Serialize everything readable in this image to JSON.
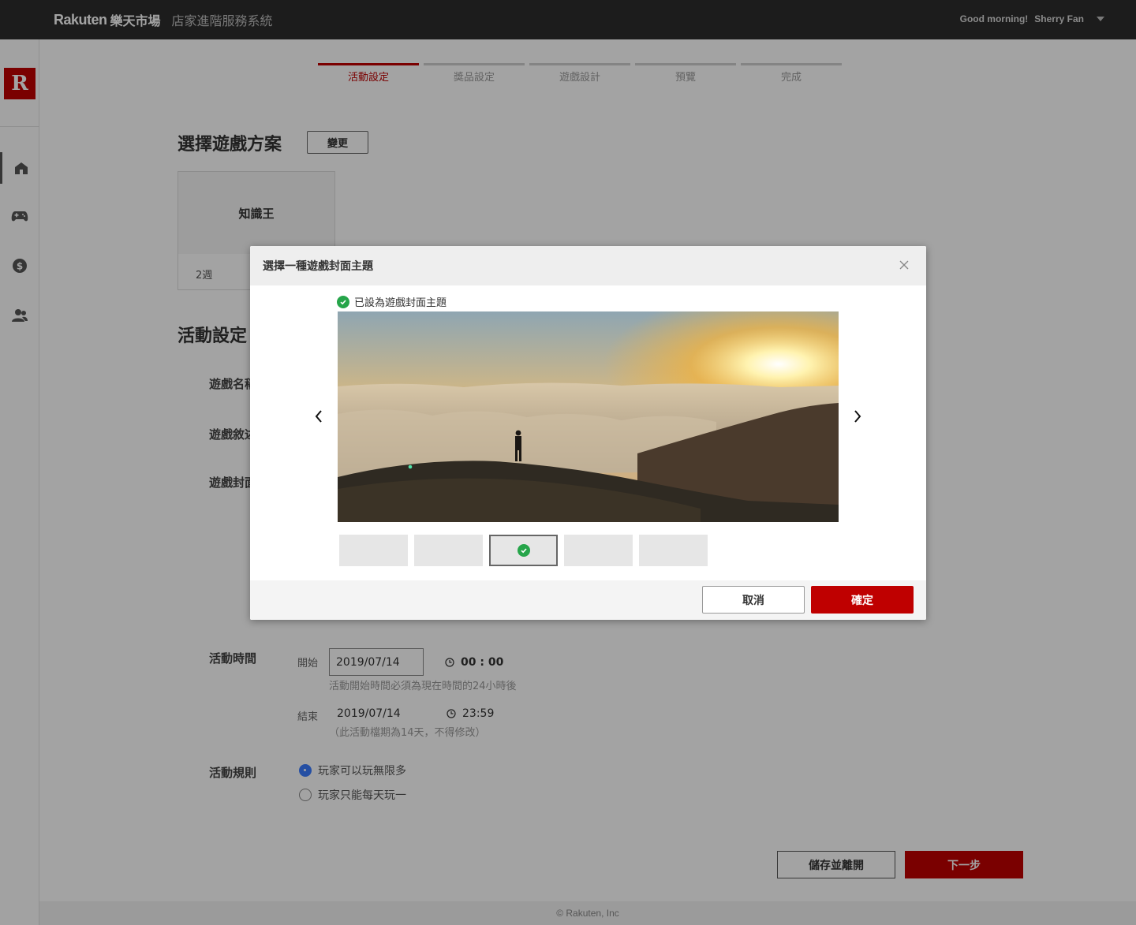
{
  "header": {
    "logo_text": "Rakuten",
    "logo_cn": "樂天市場",
    "system_title": "店家進階服務系統",
    "greeting": "Good morning!",
    "user_name": "Sherry Fan"
  },
  "sidebar": {
    "logo_letter": "R",
    "icons": [
      "home-icon",
      "gamepad-icon",
      "dollar-icon",
      "users-icon"
    ]
  },
  "steps": [
    {
      "label": "活動設定",
      "active": true
    },
    {
      "label": "獎品設定",
      "active": false
    },
    {
      "label": "遊戲設計",
      "active": false
    },
    {
      "label": "預覽",
      "active": false
    },
    {
      "label": "完成",
      "active": false
    }
  ],
  "plan_section": {
    "title": "選擇遊戲方案",
    "change_label": "變更",
    "plan_name": "知識王",
    "plan_duration": "2週"
  },
  "activity_section": {
    "title": "活動設定",
    "fields": [
      "遊戲名稱",
      "遊戲敘述",
      "遊戲封面"
    ],
    "time_label": "活動時間",
    "start_label": "開始",
    "start_date": "2019/07/14",
    "start_time": "00 : 00",
    "start_hint": "活動開始時間必須為現在時間的24小時後",
    "end_label": "結束",
    "end_date": "2019/07/14",
    "end_time": "23:59",
    "end_hint": "（此活動檔期為14天，不得修改）",
    "rules_label": "活動規則",
    "rules": [
      {
        "label": "玩家可以玩無限多",
        "checked": true
      },
      {
        "label": "玩家只能每天玩一",
        "checked": false
      }
    ]
  },
  "actions": {
    "save_label": "儲存並離開",
    "next_label": "下一步"
  },
  "footer": {
    "copyright": "© Rakuten, Inc"
  },
  "modal": {
    "title": "選擇一種遊戲封面主題",
    "selected_note": "已設為遊戲封面主題",
    "thumbnails": [
      {
        "selected": false
      },
      {
        "selected": false
      },
      {
        "selected": true
      },
      {
        "selected": false
      },
      {
        "selected": false
      }
    ],
    "cancel_label": "取消",
    "confirm_label": "確定"
  },
  "colors": {
    "brand_red": "#bf0000",
    "header_bg": "#2d2d2d",
    "check_green": "#26a54a",
    "radio_blue": "#3b7cff"
  }
}
